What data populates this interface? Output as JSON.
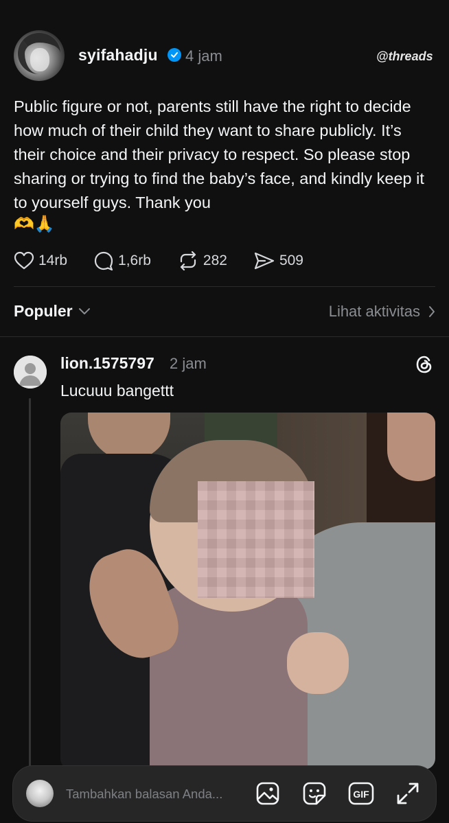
{
  "post": {
    "username": "syifahadju",
    "time": "4 jam",
    "brand": "threads",
    "text": "Public figure or not, parents still have the right to decide how much of their child they want to share publicly. It’s their choice and their privacy to respect. So please stop sharing or trying to find the baby’s face, and kindly keep it to yourself guys. Thank you",
    "emojis": "🫶🙏",
    "stats": {
      "likes": "14rb",
      "replies": "1,6rb",
      "reposts": "282",
      "shares": "509"
    }
  },
  "filter": {
    "sort_label": "Populer",
    "activity_label": "Lihat aktivitas"
  },
  "reply": {
    "username": "lion.1575797",
    "time": "2 jam",
    "text": "Lucuuu bangettt"
  },
  "composer": {
    "placeholder": "Tambahkan balasan Anda..."
  },
  "colors": {
    "background": "#101010",
    "verified": "#0095f6",
    "muted": "#8a8d91"
  }
}
